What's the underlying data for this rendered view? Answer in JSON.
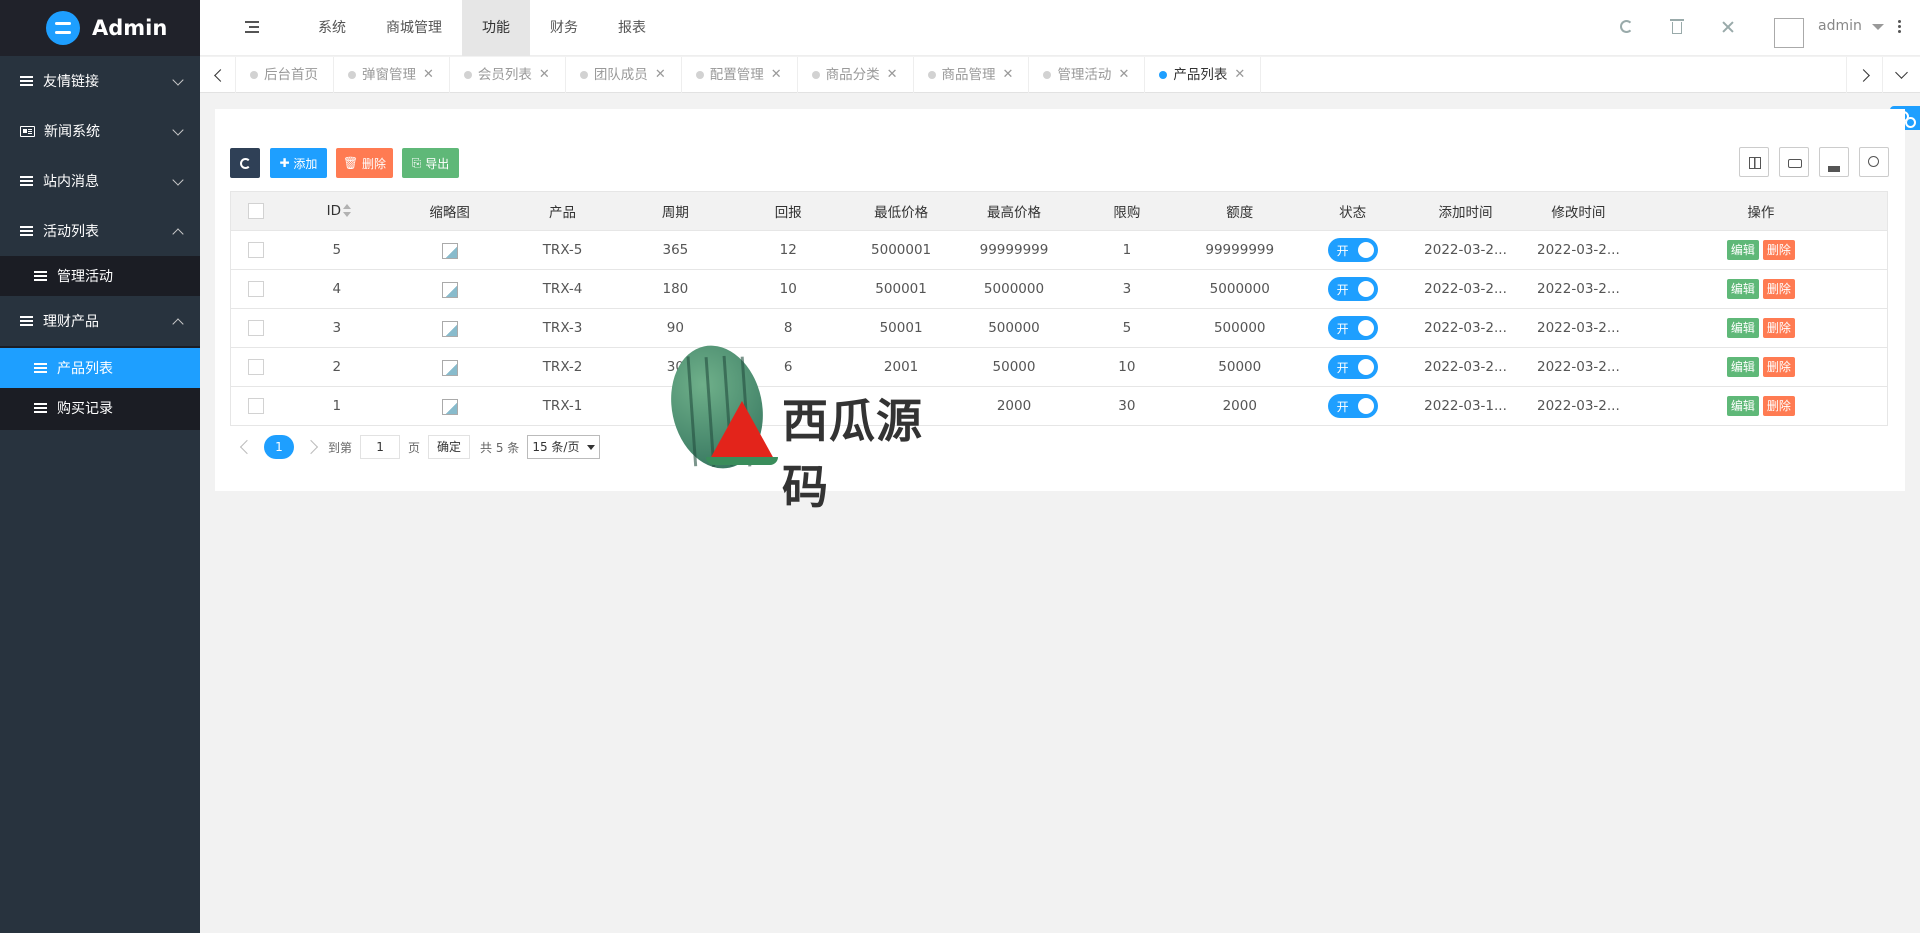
{
  "app": {
    "title": "Admin"
  },
  "sidebar": {
    "items": [
      {
        "label": "友情链接",
        "icon": "list-icon"
      },
      {
        "label": "新闻系统",
        "icon": "news-icon"
      },
      {
        "label": "站内消息",
        "icon": "list-icon"
      },
      {
        "label": "活动列表",
        "icon": "list-icon",
        "expanded": true,
        "children": [
          {
            "label": "管理活动"
          }
        ]
      },
      {
        "label": "理财产品",
        "icon": "list-icon",
        "expanded": true,
        "children": [
          {
            "label": "产品列表",
            "active": true
          },
          {
            "label": "购买记录"
          }
        ]
      }
    ]
  },
  "header": {
    "tabs": [
      "系统",
      "商城管理",
      "功能",
      "财务",
      "报表"
    ],
    "active_tab": "功能",
    "user": "admin"
  },
  "page_tabs": [
    {
      "label": "后台首页",
      "closable": false
    },
    {
      "label": "弹窗管理",
      "closable": true
    },
    {
      "label": "会员列表",
      "closable": true
    },
    {
      "label": "团队成员",
      "closable": true
    },
    {
      "label": "配置管理",
      "closable": true
    },
    {
      "label": "商品分类",
      "closable": true
    },
    {
      "label": "商品管理",
      "closable": true
    },
    {
      "label": "管理活动",
      "closable": true
    },
    {
      "label": "产品列表",
      "closable": true,
      "active": true
    }
  ],
  "toolbar": {
    "add": "添加",
    "delete": "删除",
    "export": "导出"
  },
  "table": {
    "columns": [
      "ID",
      "缩略图",
      "产品",
      "周期",
      "回报",
      "最低价格",
      "最高价格",
      "限购",
      "额度",
      "状态",
      "添加时间",
      "修改时间",
      "操作"
    ],
    "rows": [
      {
        "id": "5",
        "product": "TRX-5",
        "cycle": "365",
        "return": "12",
        "min_price": "5000001",
        "max_price": "99999999",
        "limit": "1",
        "quota": "99999999",
        "status": "开",
        "added": "2022-03-2...",
        "modified": "2022-03-2..."
      },
      {
        "id": "4",
        "product": "TRX-4",
        "cycle": "180",
        "return": "10",
        "min_price": "500001",
        "max_price": "5000000",
        "limit": "3",
        "quota": "5000000",
        "status": "开",
        "added": "2022-03-2...",
        "modified": "2022-03-2..."
      },
      {
        "id": "3",
        "product": "TRX-3",
        "cycle": "90",
        "return": "8",
        "min_price": "50001",
        "max_price": "500000",
        "limit": "5",
        "quota": "500000",
        "status": "开",
        "added": "2022-03-2...",
        "modified": "2022-03-2..."
      },
      {
        "id": "2",
        "product": "TRX-2",
        "cycle": "30",
        "return": "6",
        "min_price": "2001",
        "max_price": "50000",
        "limit": "10",
        "quota": "50000",
        "status": "开",
        "added": "2022-03-2...",
        "modified": "2022-03-2..."
      },
      {
        "id": "1",
        "product": "TRX-1",
        "cycle": "",
        "return": "",
        "min_price": "",
        "max_price": "2000",
        "limit": "30",
        "quota": "2000",
        "status": "开",
        "added": "2022-03-1...",
        "modified": "2022-03-2..."
      }
    ],
    "op_edit": "编辑",
    "op_delete": "删除"
  },
  "pager": {
    "current": "1",
    "goto_prefix": "到第",
    "goto_value": "1",
    "goto_suffix": "页",
    "confirm": "确定",
    "total": "共 5 条",
    "page_size": "15 条/页"
  },
  "watermark": {
    "text": "西瓜源码"
  },
  "colors": {
    "accent": "#1e9fff",
    "sidebar_bg": "#28333e",
    "edit": "#5fb878",
    "delete": "#ff5722"
  }
}
